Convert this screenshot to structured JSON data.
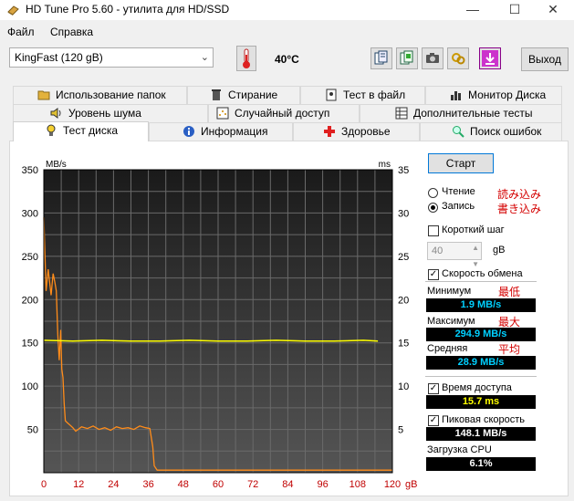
{
  "window": {
    "title": "HD Tune Pro 5.60 - утилита для HD/SSD",
    "minimize": "—",
    "maximize": "☐",
    "close": "✕"
  },
  "menu": {
    "file": "Файл",
    "help": "Справка"
  },
  "toolbar": {
    "drive": "KingFast (120 gB)",
    "temperature": "40°C",
    "exit_label": "Выход"
  },
  "tabs": {
    "row1": [
      "Использование папок",
      "Стирание",
      "Тест в файл",
      "Монитор Диска"
    ],
    "row2": [
      "Уровень шума",
      "Случайный доступ",
      "Дополнительные  тесты"
    ],
    "row3": [
      "Тест диска",
      "Информация",
      "Здоровье",
      "Поиск ошибок"
    ]
  },
  "chart_data": {
    "type": "line",
    "y_left_label": "MB/s",
    "y_right_label": "ms",
    "x_unit": "gB",
    "ylim_left": [
      0,
      350
    ],
    "ylim_right": [
      0,
      35
    ],
    "xlim": [
      0,
      120
    ],
    "y_left_ticks": [
      50,
      100,
      150,
      200,
      250,
      300,
      350
    ],
    "y_right_ticks": [
      5,
      10,
      15,
      20,
      25,
      30,
      35
    ],
    "x_ticks": [
      0,
      12,
      24,
      36,
      48,
      60,
      72,
      84,
      96,
      108,
      120
    ],
    "series": [
      {
        "color": "#ff8c1a",
        "x": [
          0,
          0.3,
          0.8,
          1.5,
          2.5,
          3.2,
          3.8,
          4.3,
          4.8,
          5.3,
          5.8,
          6.2,
          6.6,
          7.0,
          7.4,
          8,
          9,
          10,
          11,
          13,
          15,
          17,
          19,
          21,
          23,
          25,
          27,
          29,
          31,
          33,
          35,
          36.5,
          37.5,
          38,
          39,
          42,
          48,
          60,
          72,
          84,
          96,
          108,
          120
        ],
        "y": [
          295,
          260,
          210,
          235,
          205,
          230,
          220,
          210,
          160,
          130,
          165,
          120,
          110,
          80,
          60,
          58,
          55,
          52,
          48,
          53,
          51,
          54,
          50,
          52,
          49,
          53,
          51,
          52,
          50,
          54,
          52,
          51,
          30,
          8,
          3,
          3,
          3,
          3,
          3,
          3,
          3,
          3,
          3
        ]
      },
      {
        "color": "#ffff00",
        "axis": "right",
        "x": [
          0,
          10,
          20,
          30,
          40,
          50,
          60,
          70,
          80,
          90,
          100,
          110,
          115
        ],
        "y": [
          15.3,
          15.2,
          15.3,
          15.2,
          15.2,
          15.3,
          15.2,
          15.2,
          15.3,
          15.2,
          15.2,
          15.3,
          15.2
        ]
      }
    ],
    "grid": true
  },
  "panel": {
    "start_label": "Старт",
    "read_label": "Чтение",
    "write_label": "Запись",
    "read_note": "読み込み",
    "write_note": "書き込み",
    "short_step_label": "Короткий шаг",
    "block_value": "40",
    "block_unit": "gB",
    "transfer_label": "Скорость обмена",
    "min_label": "Минимум",
    "min_note": "最低",
    "min_value": "1.9 MB/s",
    "max_label": "Максимум",
    "max_note": "最大",
    "max_value": "294.9 MB/s",
    "avg_label": "Средняя",
    "avg_note": "平均",
    "avg_value": "28.9 MB/s",
    "access_label": "Время доступа",
    "access_value": "15.7 ms",
    "burst_label": "Пиковая скорость",
    "burst_value": "148.1 MB/s",
    "cpu_label": "Загрузка CPU",
    "cpu_value": "6.1%"
  }
}
